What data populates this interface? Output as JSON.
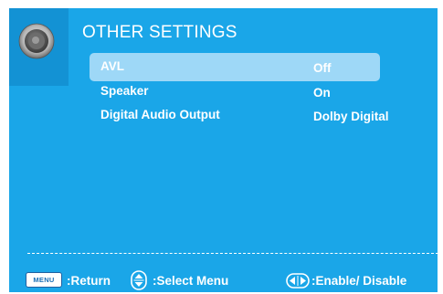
{
  "menu": {
    "title": "OTHER SETTINGS",
    "icon": "speaker-icon",
    "items": [
      {
        "label": "AVL",
        "value": "Off",
        "selected": true
      },
      {
        "label": "Speaker",
        "value": "On",
        "selected": false
      },
      {
        "label": "Digital Audio Output",
        "value": "Dolby Digital",
        "selected": false
      }
    ]
  },
  "footer": {
    "menu_key": "MENU",
    "return_label": ":Return",
    "select_label": ":Select Menu",
    "enable_label": ":Enable/ Disable"
  },
  "colors": {
    "panel": "#1aa6e8",
    "icon_box": "#1392d4",
    "selected_row": "#9ed8f7",
    "text": "#ffffff"
  }
}
